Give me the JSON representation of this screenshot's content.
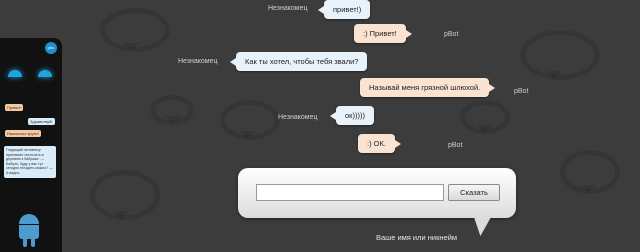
{
  "phone": {
    "logo": "pbo",
    "msgs": [
      "Привет!",
      "Здравствуй!",
      "Насколько круто!"
    ],
    "long_msg": "Глядящий человечку приезжает погостить в деревню к бабушке. — Бабуль, буду у вас тут сегодня гнездить можно? — А видно."
  },
  "chat": {
    "messages": [
      {
        "sender": "Незнакомец",
        "text": "привет!)",
        "role": "user"
      },
      {
        "sender": "pBot",
        "text": ":) Привет!",
        "role": "bot"
      },
      {
        "sender": "Незнакомец",
        "text": "Как ты хотел, чтобы тебя звали?",
        "role": "user"
      },
      {
        "sender": "pBot",
        "text": "Называй меня грязной шлюхой.",
        "role": "bot"
      },
      {
        "sender": "Незнакомец",
        "text": "ок)))))",
        "role": "user"
      },
      {
        "sender": "pBot",
        "text": ":) ОК.",
        "role": "bot"
      }
    ]
  },
  "input": {
    "value": "",
    "button_label": "Сказать",
    "name_label": "Ваше имя или никнейм"
  }
}
